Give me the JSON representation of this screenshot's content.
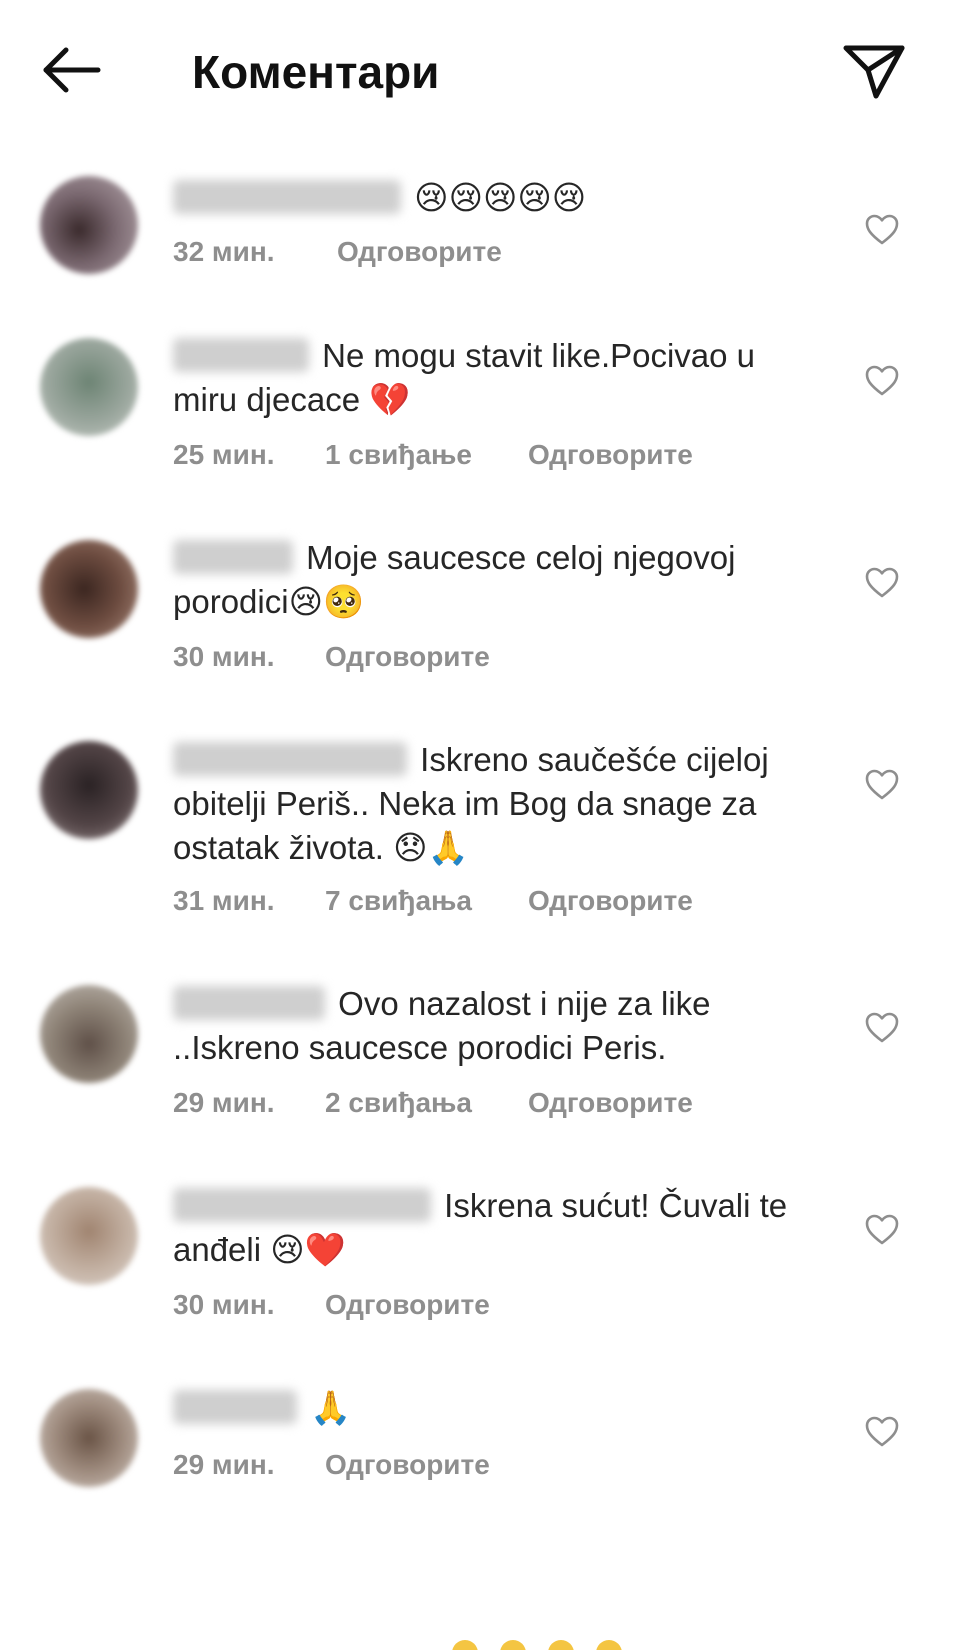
{
  "header": {
    "title": "Коментари",
    "back_icon": "arrow-left-icon",
    "send_icon": "paper-plane-icon"
  },
  "colors": {
    "meta_text": "#8e8e8e",
    "text": "#262626",
    "heart_outline": "#8e8e8e",
    "broken_heart": "#e0245e",
    "red_heart": "#e0245e"
  },
  "reply_label": "Одговорите",
  "comments": [
    {
      "text": "😢😢😢😢😢",
      "time": "32 мин.",
      "likes": "",
      "avatar_color": "#6b5a5c"
    },
    {
      "text": "Ne mogu stavit like.Pocivao u miru djecace 💔",
      "time": "25 мин.",
      "likes": "1 свиђање",
      "avatar_color": "#7b8a7f"
    },
    {
      "text": "Moje saucesce celoj njegovoj porodici😢🥺",
      "time": "30 мин.",
      "likes": "",
      "avatar_color": "#5b4036"
    },
    {
      "text": "Iskreno saučešće cijeloj obitelji Periš.. Neka im Bog da snage za ostatak života. 😞🙏",
      "time": "31 мин.",
      "likes": "7 свиђања",
      "avatar_color": "#3e3536"
    },
    {
      "text": "Ovo nazalost i nije za like ..Iskreno saucesce porodici Peris.",
      "time": "29 мин.",
      "likes": "2 свиђања",
      "avatar_color": "#8a8078"
    },
    {
      "text": "Iskrena sućut! Čuvali te anđeli 😢❤️",
      "time": "30 мин.",
      "likes": "",
      "avatar_color": "#b8a596"
    },
    {
      "text": "🙏",
      "time": "29 мин.",
      "likes": "",
      "avatar_color": "#8c7868"
    }
  ]
}
